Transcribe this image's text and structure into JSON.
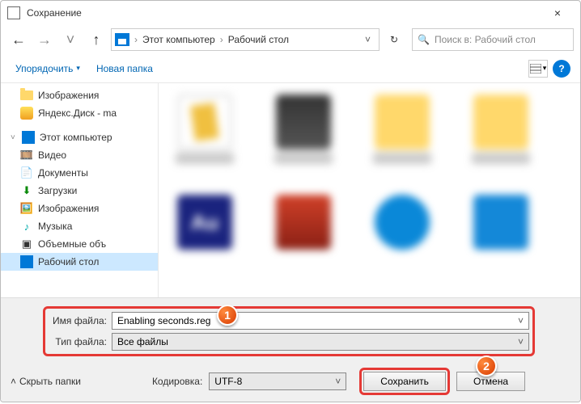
{
  "title": "Сохранение",
  "close": "×",
  "nav": {
    "back": "←",
    "forward": "→",
    "up": "↑",
    "refresh": "↻",
    "drop": "˅"
  },
  "path": {
    "root": "Этот компьютер",
    "current": "Рабочий стол",
    "sep": "›"
  },
  "search": {
    "icon": "🔍",
    "placeholder": "Поиск в: Рабочий стол"
  },
  "toolbar": {
    "organize": "Упорядочить",
    "drop": "▾",
    "newfolder": "Новая папка",
    "help": "?"
  },
  "sidebar": {
    "images": "Изображения",
    "yadisk": "Яндекс.Диск - ma",
    "pc": "Этот компьютер",
    "video": "Видео",
    "documents": "Документы",
    "downloads": "Загрузки",
    "images2": "Изображения",
    "music": "Музыка",
    "volumes": "Объемные объ",
    "desktop": "Рабочий стол"
  },
  "fields": {
    "name_label": "Имя файла:",
    "name_value": "Enabling seconds.reg",
    "type_label": "Тип файла:",
    "type_value": "Все файлы",
    "drop": "˅"
  },
  "bottom": {
    "hide": "Скрыть папки",
    "chev": "˄",
    "encoding_label": "Кодировка:",
    "encoding_value": "UTF-8",
    "save": "Сохранить",
    "cancel": "Отмена",
    "drop": "˅"
  },
  "badges": {
    "one": "1",
    "two": "2"
  }
}
